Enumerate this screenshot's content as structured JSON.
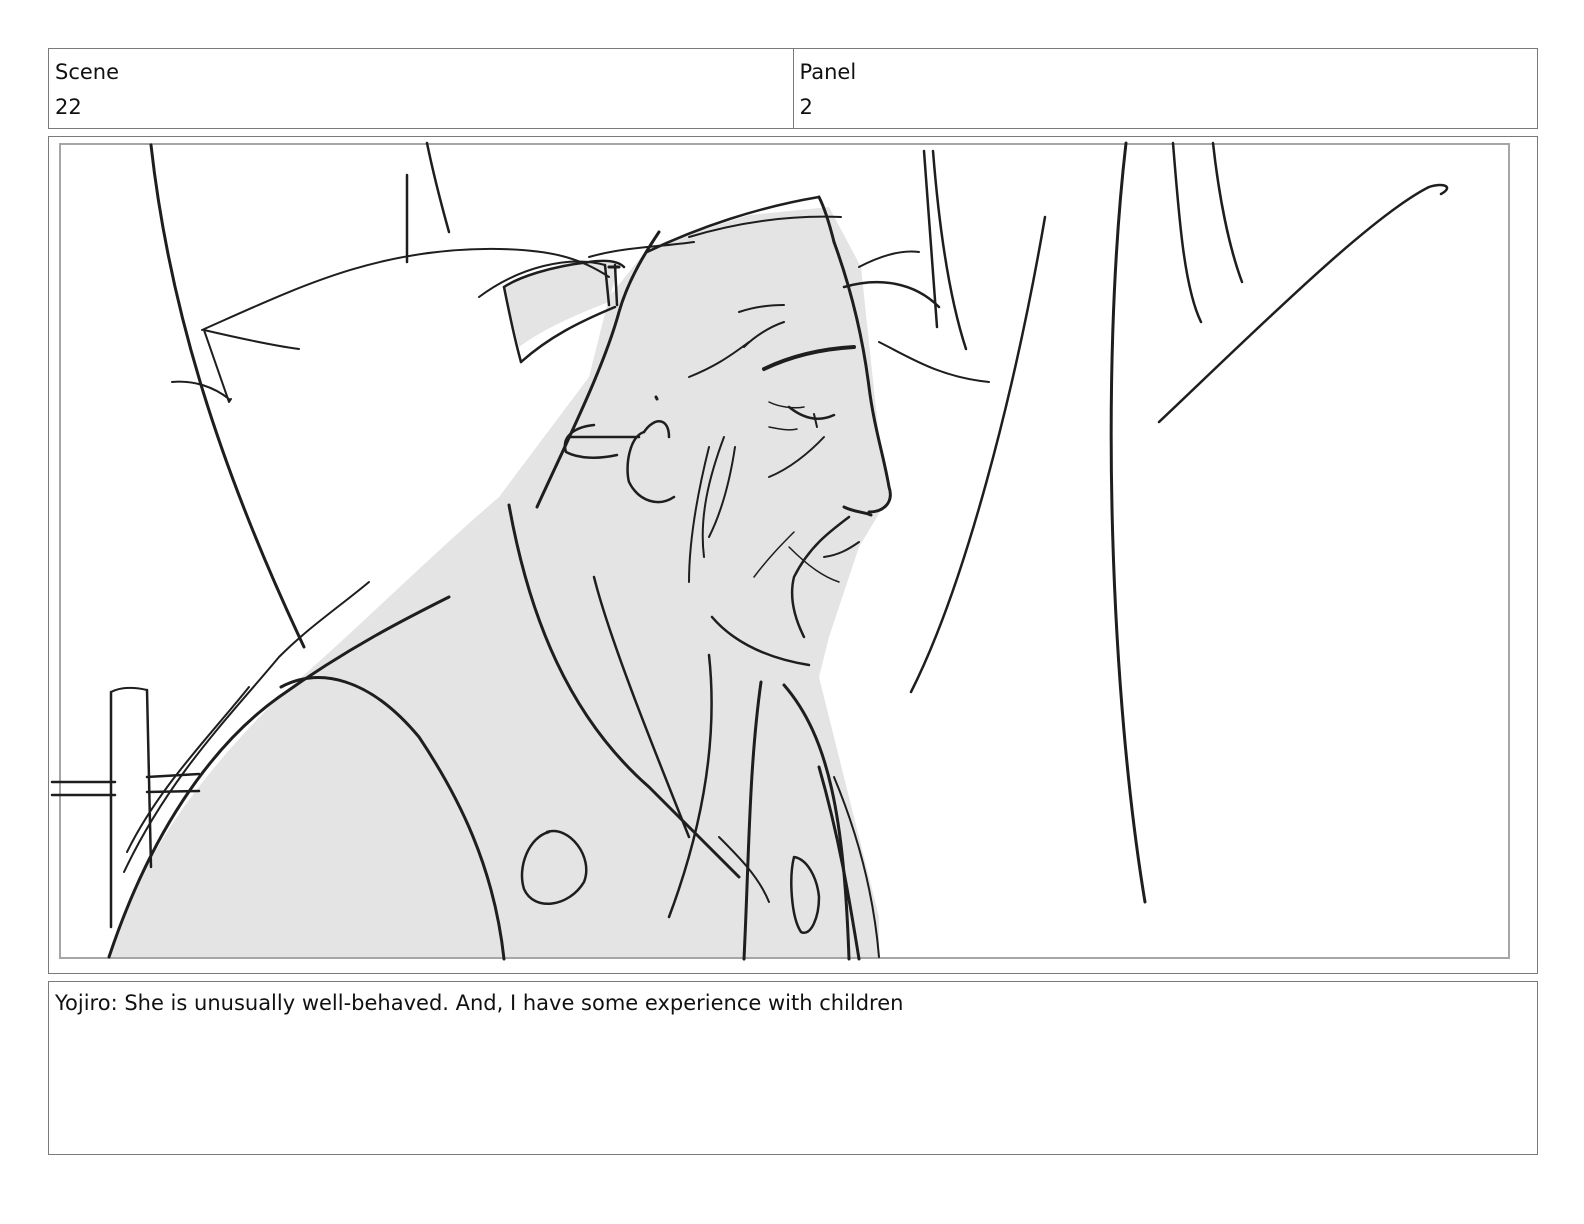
{
  "scene": {
    "label": "Scene",
    "value": "22"
  },
  "panel": {
    "label": "Panel",
    "value": "2"
  },
  "drawing": {
    "subject": "sketch-of-bearded-man-in-profile"
  },
  "caption": {
    "text": "Yojiro: She is unusually well-behaved. And, I have some experience with children"
  }
}
